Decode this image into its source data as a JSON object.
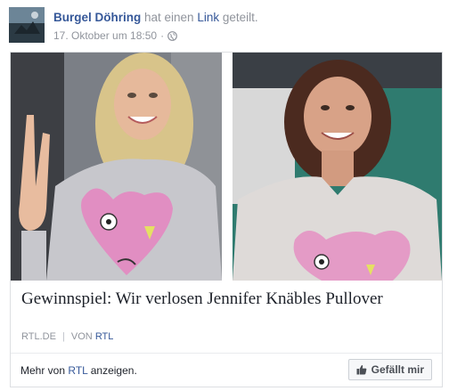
{
  "post": {
    "author": "Burgel Döhring",
    "action_prefix": "hat einen",
    "action_link": "Link",
    "action_suffix": "geteilt.",
    "timestamp": "17. Oktober um 18:50",
    "separator": "·",
    "privacy_icon": "globe-icon"
  },
  "card": {
    "title": "Gewinnspiel: Wir verlosen Jennifer Knäbles Pullover",
    "source_domain": "RTL.DE",
    "source_sep": "|",
    "source_by": "VON",
    "source_name": "RTL",
    "more_prefix": "Mehr von",
    "more_brand": "RTL",
    "more_suffix": "anzeigen.",
    "like_label": "Gefällt mir",
    "like_icon": "thumbs-up-icon"
  },
  "colors": {
    "link_blue": "#365899",
    "meta_gray": "#90949c",
    "border": "#dddfe2"
  }
}
